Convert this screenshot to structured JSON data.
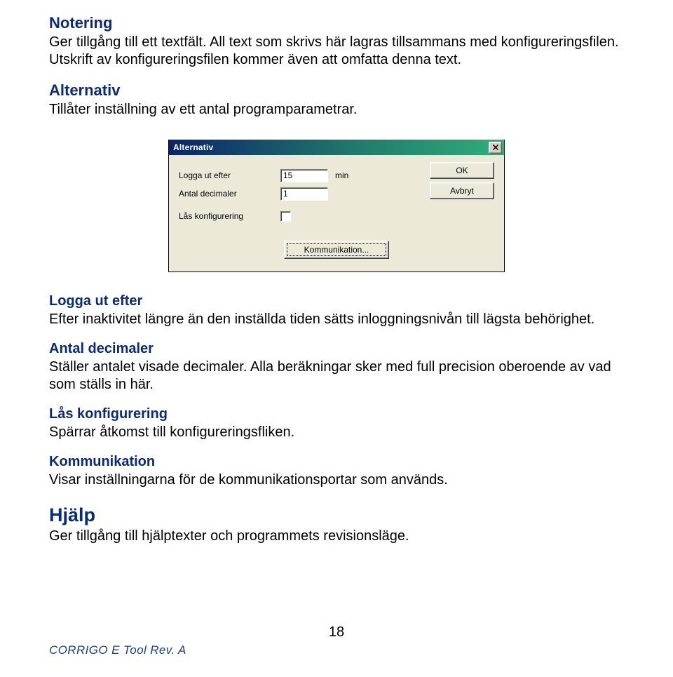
{
  "sections": {
    "notering": {
      "heading": "Notering",
      "body1": "Ger tillgång till ett textfält. All text som skrivs här lagras tillsammans med konfigureringsfilen. Utskrift av konfigureringsfilen kommer även att omfatta denna text."
    },
    "alternativ": {
      "heading": "Alternativ",
      "body1": "Tillåter inställning av ett antal programparametrar."
    },
    "logga_ut": {
      "heading": "Logga ut efter",
      "body1": "Efter inaktivitet längre än den inställda tiden sätts inloggningsnivån till lägsta behörighet."
    },
    "antal_dec": {
      "heading": "Antal decimaler",
      "body1": "Ställer antalet visade decimaler. Alla beräkningar sker med full precision oberoende av vad som ställs in här."
    },
    "las_konf": {
      "heading": "Lås konfigurering",
      "body1": "Spärrar åtkomst till konfigureringsfliken."
    },
    "komm": {
      "heading": "Kommunikation",
      "body1": "Visar inställningarna för de kommunikationsportar som används."
    },
    "hjalp": {
      "heading": "Hjälp",
      "body1": "Ger tillgång till hjälptexter och programmets revisionsläge."
    }
  },
  "dialog": {
    "title": "Alternativ",
    "labels": {
      "logga_ut": "Logga ut efter",
      "antal_dec": "Antal decimaler",
      "las_konf": "Lås konfigurering"
    },
    "values": {
      "logga_ut": "15",
      "antal_dec": "1"
    },
    "unit_min": "min",
    "buttons": {
      "ok": "OK",
      "avbryt": "Avbryt",
      "kommunikation": "Kommunikation..."
    }
  },
  "footer": {
    "page_number": "18",
    "doc_info": "CORRIGO E Tool  Rev. A"
  }
}
